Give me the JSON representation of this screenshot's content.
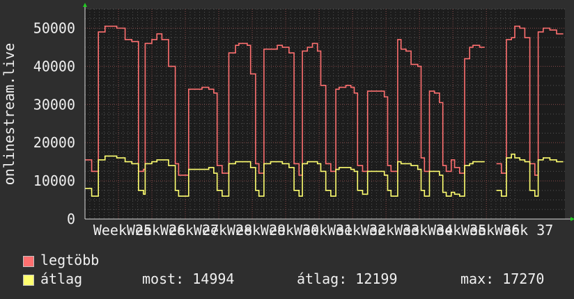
{
  "chart_data": {
    "type": "line",
    "ylabel": "onlinestream.live",
    "ylim": [
      0,
      55000
    ],
    "y_ticks": [
      0,
      10000,
      20000,
      30000,
      40000,
      50000
    ],
    "y_tick_labels": [
      "0",
      "10000",
      "20000",
      "30000",
      "40000",
      "50000"
    ],
    "x_tick_labels": [
      "Week 25",
      "Week 26",
      "Week 27",
      "Week 28",
      "Week 29",
      "Week 30",
      "Week 31",
      "Week 32",
      "Week 33",
      "Week 34",
      "Week 35",
      "Week 36",
      "Week 37"
    ],
    "grid": true,
    "series": [
      {
        "name": "legtöbb",
        "color": "#ff7070",
        "points": [
          [
            0.0,
            15500
          ],
          [
            0.2,
            12500
          ],
          [
            0.4,
            49000
          ],
          [
            0.6,
            50500
          ],
          [
            0.95,
            50000
          ],
          [
            1.2,
            47000
          ],
          [
            1.4,
            46500
          ],
          [
            1.6,
            12500
          ],
          [
            1.75,
            13000
          ],
          [
            1.8,
            46000
          ],
          [
            2.0,
            47000
          ],
          [
            2.15,
            48500
          ],
          [
            2.3,
            47000
          ],
          [
            2.5,
            40000
          ],
          [
            2.7,
            14500
          ],
          [
            2.8,
            11500
          ],
          [
            2.95,
            11500
          ],
          [
            3.1,
            34000
          ],
          [
            3.3,
            34000
          ],
          [
            3.5,
            34500
          ],
          [
            3.7,
            34000
          ],
          [
            3.85,
            33000
          ],
          [
            3.95,
            14000
          ],
          [
            4.1,
            12000
          ],
          [
            4.3,
            43500
          ],
          [
            4.5,
            45500
          ],
          [
            4.6,
            46000
          ],
          [
            4.85,
            45500
          ],
          [
            4.95,
            38000
          ],
          [
            5.1,
            14500
          ],
          [
            5.2,
            12000
          ],
          [
            5.35,
            44500
          ],
          [
            5.55,
            44500
          ],
          [
            5.75,
            45500
          ],
          [
            5.9,
            45000
          ],
          [
            6.1,
            43500
          ],
          [
            6.25,
            14500
          ],
          [
            6.4,
            11500
          ],
          [
            6.5,
            44000
          ],
          [
            6.65,
            45000
          ],
          [
            6.8,
            46000
          ],
          [
            6.95,
            44000
          ],
          [
            7.05,
            35000
          ],
          [
            7.2,
            14500
          ],
          [
            7.35,
            12500
          ],
          [
            7.5,
            34000
          ],
          [
            7.6,
            34500
          ],
          [
            7.8,
            35000
          ],
          [
            7.95,
            34500
          ],
          [
            8.05,
            33000
          ],
          [
            8.15,
            14000
          ],
          [
            8.3,
            12500
          ],
          [
            8.45,
            33500
          ],
          [
            8.6,
            33500
          ],
          [
            8.8,
            33500
          ],
          [
            8.95,
            32000
          ],
          [
            9.05,
            14000
          ],
          [
            9.15,
            12500
          ],
          [
            9.35,
            47000
          ],
          [
            9.45,
            44500
          ],
          [
            9.6,
            44000
          ],
          [
            9.75,
            40500
          ],
          [
            9.95,
            40000
          ],
          [
            10.05,
            16000
          ],
          [
            10.15,
            12500
          ],
          [
            10.3,
            33500
          ],
          [
            10.45,
            33000
          ],
          [
            10.6,
            30500
          ],
          [
            10.7,
            14000
          ],
          [
            10.8,
            12500
          ],
          [
            10.95,
            15500
          ],
          [
            11.05,
            13500
          ],
          [
            11.2,
            12000
          ],
          [
            11.35,
            42000
          ],
          [
            11.5,
            45000
          ],
          [
            11.6,
            45500
          ],
          [
            11.8,
            45000
          ],
          [
            11.95,
            45000
          ],
          [
            11.98,
            null
          ],
          [
            12.3,
            14500
          ],
          [
            12.45,
            12000
          ],
          [
            12.6,
            47000
          ],
          [
            12.75,
            47500
          ],
          [
            12.85,
            50500
          ],
          [
            13.0,
            50000
          ],
          [
            13.15,
            47500
          ],
          [
            13.3,
            14500
          ],
          [
            13.45,
            11500
          ],
          [
            13.55,
            49000
          ],
          [
            13.7,
            50000
          ],
          [
            13.9,
            49500
          ],
          [
            14.1,
            48500
          ],
          [
            14.3,
            48500
          ]
        ]
      },
      {
        "name": "átlag",
        "color": "#ffff70",
        "points": [
          [
            0.0,
            8000
          ],
          [
            0.2,
            6000
          ],
          [
            0.4,
            15500
          ],
          [
            0.6,
            16500
          ],
          [
            0.95,
            16000
          ],
          [
            1.2,
            15000
          ],
          [
            1.4,
            14500
          ],
          [
            1.6,
            7500
          ],
          [
            1.75,
            6500
          ],
          [
            1.8,
            14500
          ],
          [
            2.0,
            15000
          ],
          [
            2.15,
            15500
          ],
          [
            2.3,
            15500
          ],
          [
            2.5,
            14000
          ],
          [
            2.7,
            7500
          ],
          [
            2.8,
            6000
          ],
          [
            2.95,
            6000
          ],
          [
            3.1,
            13000
          ],
          [
            3.3,
            13000
          ],
          [
            3.5,
            13000
          ],
          [
            3.7,
            13500
          ],
          [
            3.85,
            12000
          ],
          [
            3.95,
            7500
          ],
          [
            4.1,
            6000
          ],
          [
            4.3,
            14500
          ],
          [
            4.5,
            15000
          ],
          [
            4.6,
            15000
          ],
          [
            4.85,
            15000
          ],
          [
            4.95,
            13500
          ],
          [
            5.1,
            7500
          ],
          [
            5.2,
            6000
          ],
          [
            5.35,
            14500
          ],
          [
            5.55,
            15000
          ],
          [
            5.75,
            15000
          ],
          [
            5.9,
            14500
          ],
          [
            6.1,
            13500
          ],
          [
            6.25,
            7500
          ],
          [
            6.4,
            6000
          ],
          [
            6.5,
            14500
          ],
          [
            6.65,
            15000
          ],
          [
            6.8,
            15000
          ],
          [
            6.95,
            14500
          ],
          [
            7.05,
            12500
          ],
          [
            7.2,
            7500
          ],
          [
            7.35,
            6000
          ],
          [
            7.5,
            13000
          ],
          [
            7.6,
            13500
          ],
          [
            7.8,
            13500
          ],
          [
            7.95,
            13000
          ],
          [
            8.05,
            12500
          ],
          [
            8.15,
            7500
          ],
          [
            8.3,
            6500
          ],
          [
            8.45,
            12500
          ],
          [
            8.6,
            12500
          ],
          [
            8.8,
            12500
          ],
          [
            8.95,
            11500
          ],
          [
            9.05,
            7500
          ],
          [
            9.15,
            6000
          ],
          [
            9.35,
            15000
          ],
          [
            9.45,
            14500
          ],
          [
            9.6,
            14500
          ],
          [
            9.75,
            14000
          ],
          [
            9.95,
            13000
          ],
          [
            10.05,
            7500
          ],
          [
            10.15,
            6000
          ],
          [
            10.3,
            12500
          ],
          [
            10.45,
            12500
          ],
          [
            10.6,
            11500
          ],
          [
            10.7,
            7000
          ],
          [
            10.8,
            6000
          ],
          [
            10.95,
            7000
          ],
          [
            11.05,
            6500
          ],
          [
            11.2,
            6000
          ],
          [
            11.35,
            14000
          ],
          [
            11.5,
            14500
          ],
          [
            11.6,
            15000
          ],
          [
            11.8,
            15000
          ],
          [
            11.95,
            15000
          ],
          [
            11.98,
            null
          ],
          [
            12.3,
            7500
          ],
          [
            12.45,
            6000
          ],
          [
            12.6,
            16000
          ],
          [
            12.75,
            17000
          ],
          [
            12.85,
            16000
          ],
          [
            13.0,
            15500
          ],
          [
            13.15,
            15000
          ],
          [
            13.3,
            7500
          ],
          [
            13.45,
            6000
          ],
          [
            13.55,
            15500
          ],
          [
            13.7,
            16000
          ],
          [
            13.9,
            15500
          ],
          [
            14.1,
            15000
          ],
          [
            14.3,
            15000
          ]
        ]
      }
    ]
  },
  "legend": {
    "max_label": "legtöbb",
    "avg_label": "átlag",
    "now_text": "most: 14994",
    "avg_text": "átlag: 12199",
    "max_text": "max: 17270"
  }
}
